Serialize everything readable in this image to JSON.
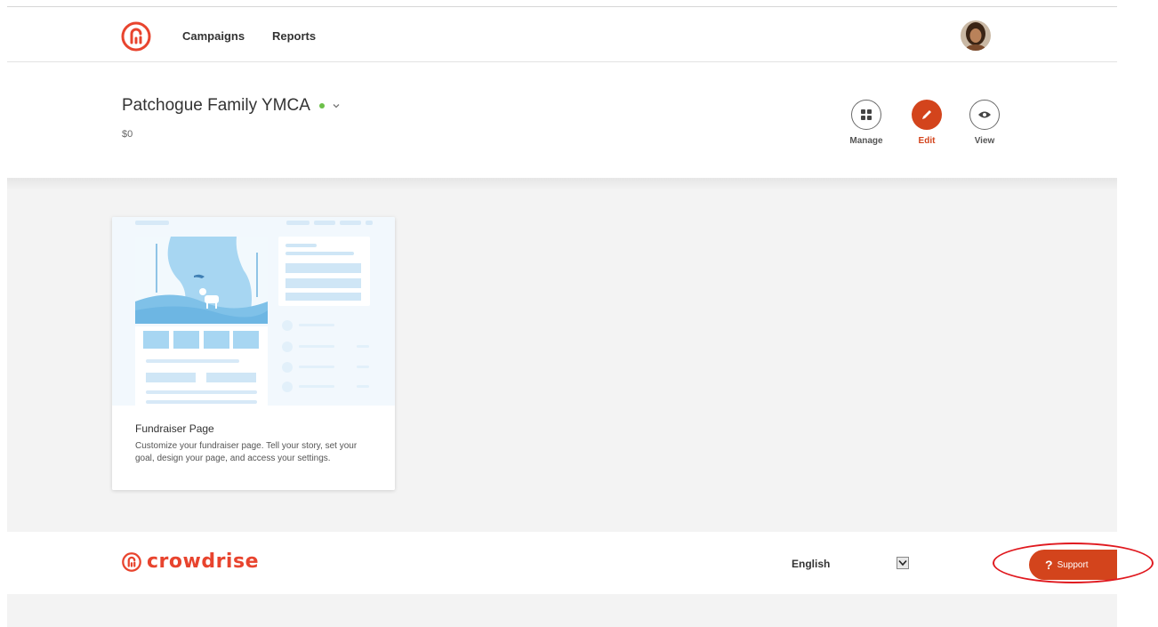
{
  "header": {
    "nav": [
      {
        "label": "Campaigns"
      },
      {
        "label": "Reports"
      }
    ]
  },
  "campaign": {
    "title": "Patchogue Family YMCA",
    "amount": "$0",
    "status_color": "#6cc04a"
  },
  "actions": {
    "manage_label": "Manage",
    "edit_label": "Edit",
    "view_label": "View"
  },
  "card": {
    "title": "Fundraiser Page",
    "description": "Customize your fundraiser page. Tell your story, set your goal, design your page, and access your settings."
  },
  "footer": {
    "brand": "crowdrise",
    "language_label": "English",
    "support_label": "Support",
    "support_icon": "?"
  },
  "colors": {
    "accent": "#d3441c",
    "brand": "#e8442e",
    "highlight": "#e0191f"
  }
}
